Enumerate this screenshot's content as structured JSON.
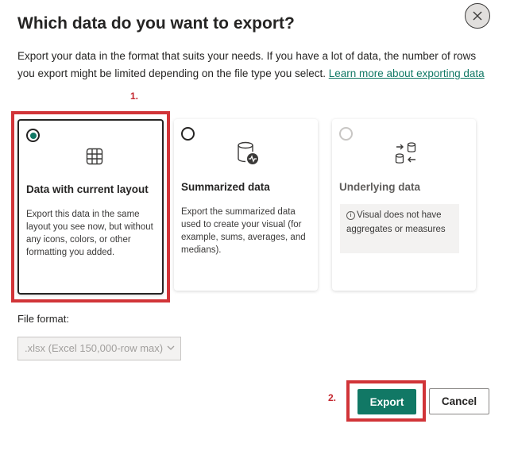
{
  "dialog": {
    "title": "Which data do you want to export?",
    "description": "Export your data in the format that suits your needs. If you have a lot of data, the number of rows you export might be limited depending on the file type you select.",
    "learn_more_link": "Learn more about exporting data"
  },
  "annotations": {
    "step1": "1.",
    "step2": "2."
  },
  "options": [
    {
      "title": "Data with current layout",
      "text": "Export this data in the same layout you see now, but without any icons, colors, or other formatting you added.",
      "selected": true,
      "icon": "table-icon"
    },
    {
      "title": "Summarized data",
      "text": "Export the summarized data used to create your visual (for example, sums, averages, and medians).",
      "selected": false,
      "icon": "database-chart-icon"
    },
    {
      "title": "Underlying data",
      "info": "Visual does not have aggregates or measures",
      "selected": false,
      "disabled": true,
      "icon": "database-transfer-icon"
    }
  ],
  "file_format": {
    "label": "File format:",
    "value": ".xlsx (Excel 150,000-row max)"
  },
  "buttons": {
    "export": "Export",
    "cancel": "Cancel"
  },
  "colors": {
    "accent": "#117865",
    "highlight": "#d13438"
  }
}
